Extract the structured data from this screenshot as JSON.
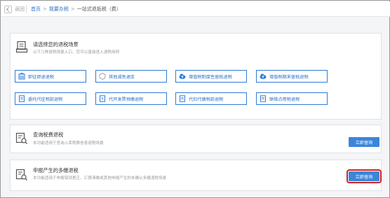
{
  "header": {
    "back_label": "返回",
    "breadcrumb": [
      "首页",
      "我要办税",
      "一站式退抵税（费）"
    ],
    "breadcrumb_sep": ">"
  },
  "scenario_panel": {
    "title": "请选择您的退税场景",
    "subtitle": "以下几种退税场景入口，您可以直接进入退税用例",
    "items": [
      {
        "label": "即征即退退税",
        "icon": "building-icon"
      },
      {
        "label": "其他减免退库",
        "icon": "shield-icon"
      },
      {
        "label": "增值税制度性留抵退税",
        "icon": "cloud-upload-icon"
      },
      {
        "label": "增值税期末留抵退税",
        "icon": "cloud-upload-icon"
      },
      {
        "label": "委托代征税款退税",
        "icon": "document-icon"
      },
      {
        "label": "代开发票预缴退税",
        "icon": "invoice-icon"
      },
      {
        "label": "代扣代缴税款退税",
        "icon": "document-icon"
      },
      {
        "label": "联络点用税退税",
        "icon": "document-icon"
      }
    ]
  },
  "query_panels": [
    {
      "title": "查询税费退税",
      "subtitle": "本功能适用于查询入库税费信息退税场景",
      "button": "立即查询"
    },
    {
      "title": "申报产生的多缴退税",
      "subtitle": "本功能适用于申报错误更正、汇算清缴或其他申报产生的未确认多缴退税场景",
      "button": "立即查询"
    }
  ],
  "colors": {
    "accent": "#2f7bd8",
    "button": "#3b86d9",
    "highlight": "#c0262c"
  }
}
